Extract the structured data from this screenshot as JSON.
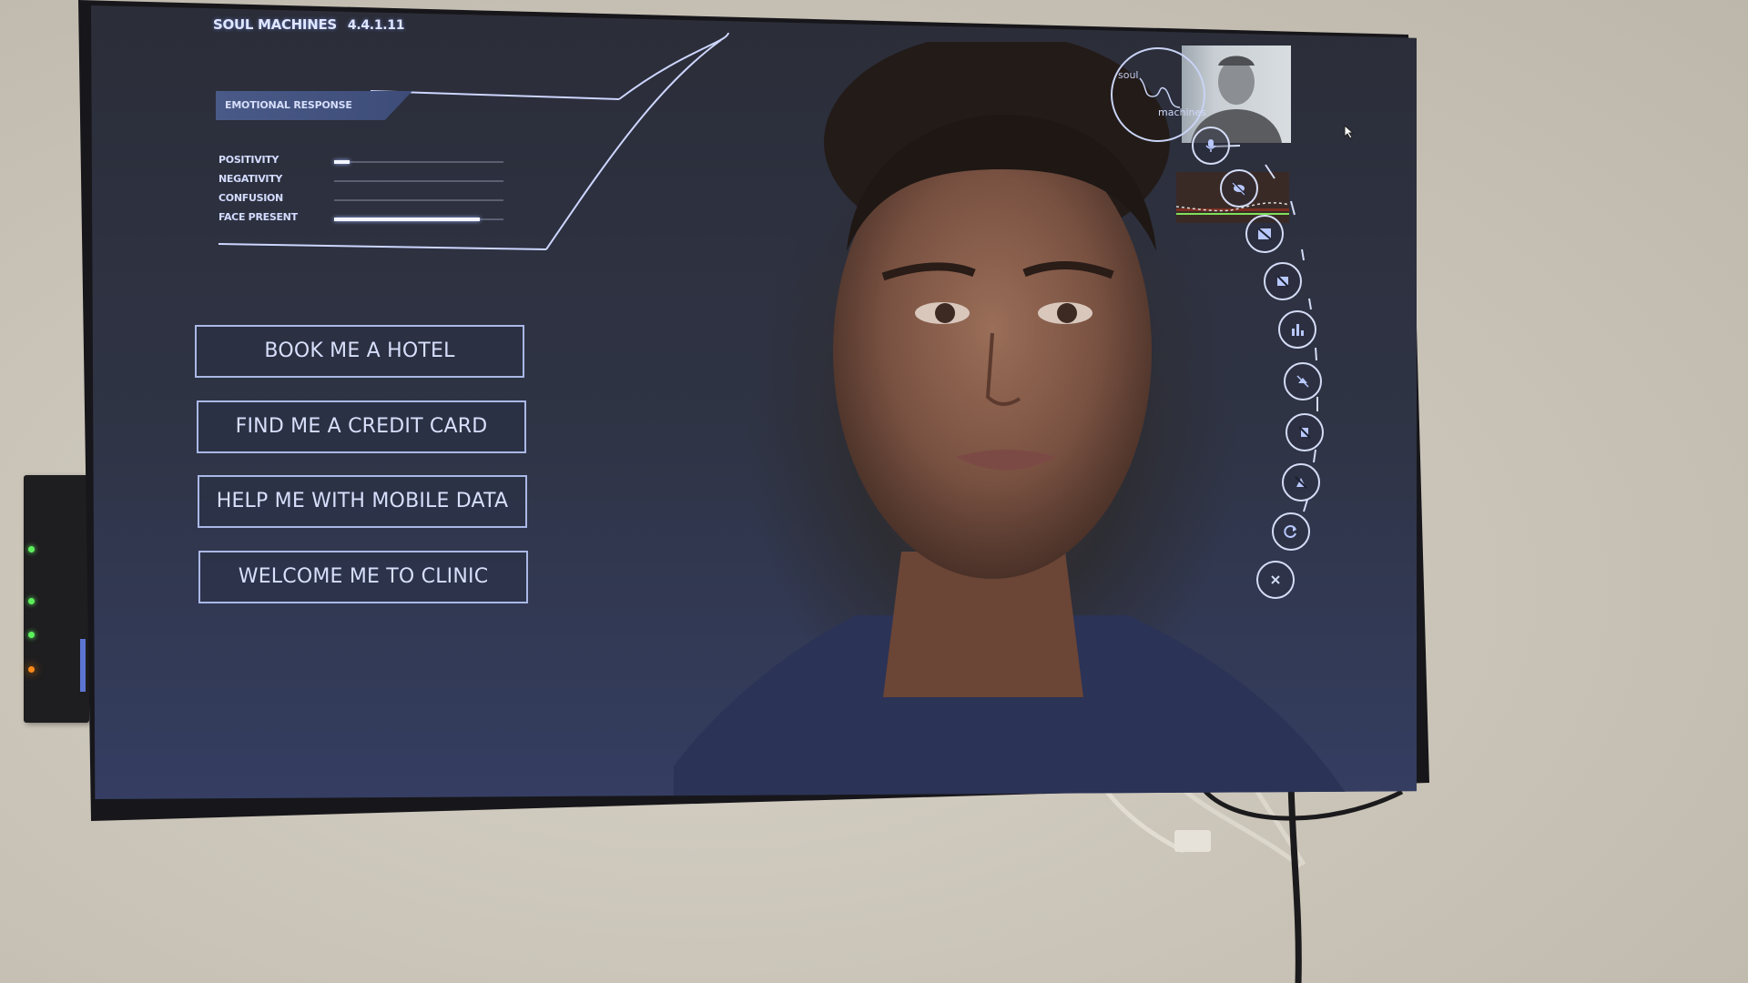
{
  "app": {
    "brand": "SOUL MACHINES",
    "version": "4.4.1.11"
  },
  "emotional_response": {
    "title": "EMOTIONAL RESPONSE",
    "metrics": [
      {
        "label": "POSITIVITY",
        "value": 0.09
      },
      {
        "label": "NEGATIVITY",
        "value": 0.0
      },
      {
        "label": "CONFUSION",
        "value": 0.0
      },
      {
        "label": "FACE PRESENT",
        "value": 0.86
      }
    ]
  },
  "quick_actions": [
    {
      "label": "BOOK ME A HOTEL"
    },
    {
      "label": "FIND ME A CREDIT CARD"
    },
    {
      "label": "HELP ME WITH MOBILE DATA"
    },
    {
      "label": "WELCOME ME TO CLINIC"
    }
  ],
  "logo": {
    "line1": "soul",
    "line2": "machines"
  },
  "controls": [
    {
      "name": "microphone-icon"
    },
    {
      "name": "mute-audio-icon"
    },
    {
      "name": "camera-off-icon"
    },
    {
      "name": "video-off-icon"
    },
    {
      "name": "bar-chart-icon"
    },
    {
      "name": "face-tracking-off-icon"
    },
    {
      "name": "gaze-off-icon"
    },
    {
      "name": "attention-off-icon"
    },
    {
      "name": "refresh-icon"
    },
    {
      "name": "close-icon"
    }
  ],
  "colors": {
    "accent": "#aab8e6",
    "text": "#d7dffb",
    "screen_bg": "#2f3446"
  }
}
